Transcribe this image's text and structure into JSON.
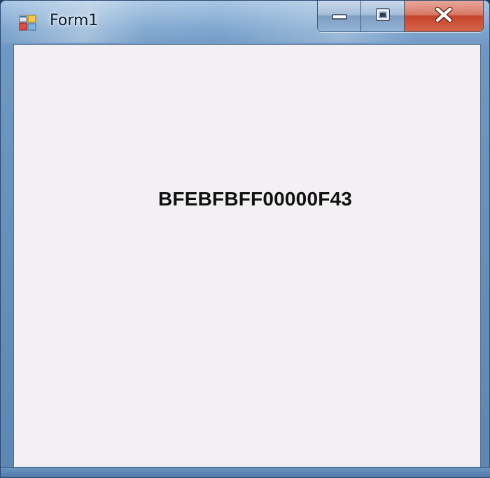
{
  "window": {
    "title": "Form1",
    "icon": "winforms-app-icon"
  },
  "caption_buttons": {
    "minimize": "minimize-icon",
    "maximize": "restore-icon",
    "close": "close-icon"
  },
  "content": {
    "label_text": "BFEBFBFF00000F43"
  }
}
